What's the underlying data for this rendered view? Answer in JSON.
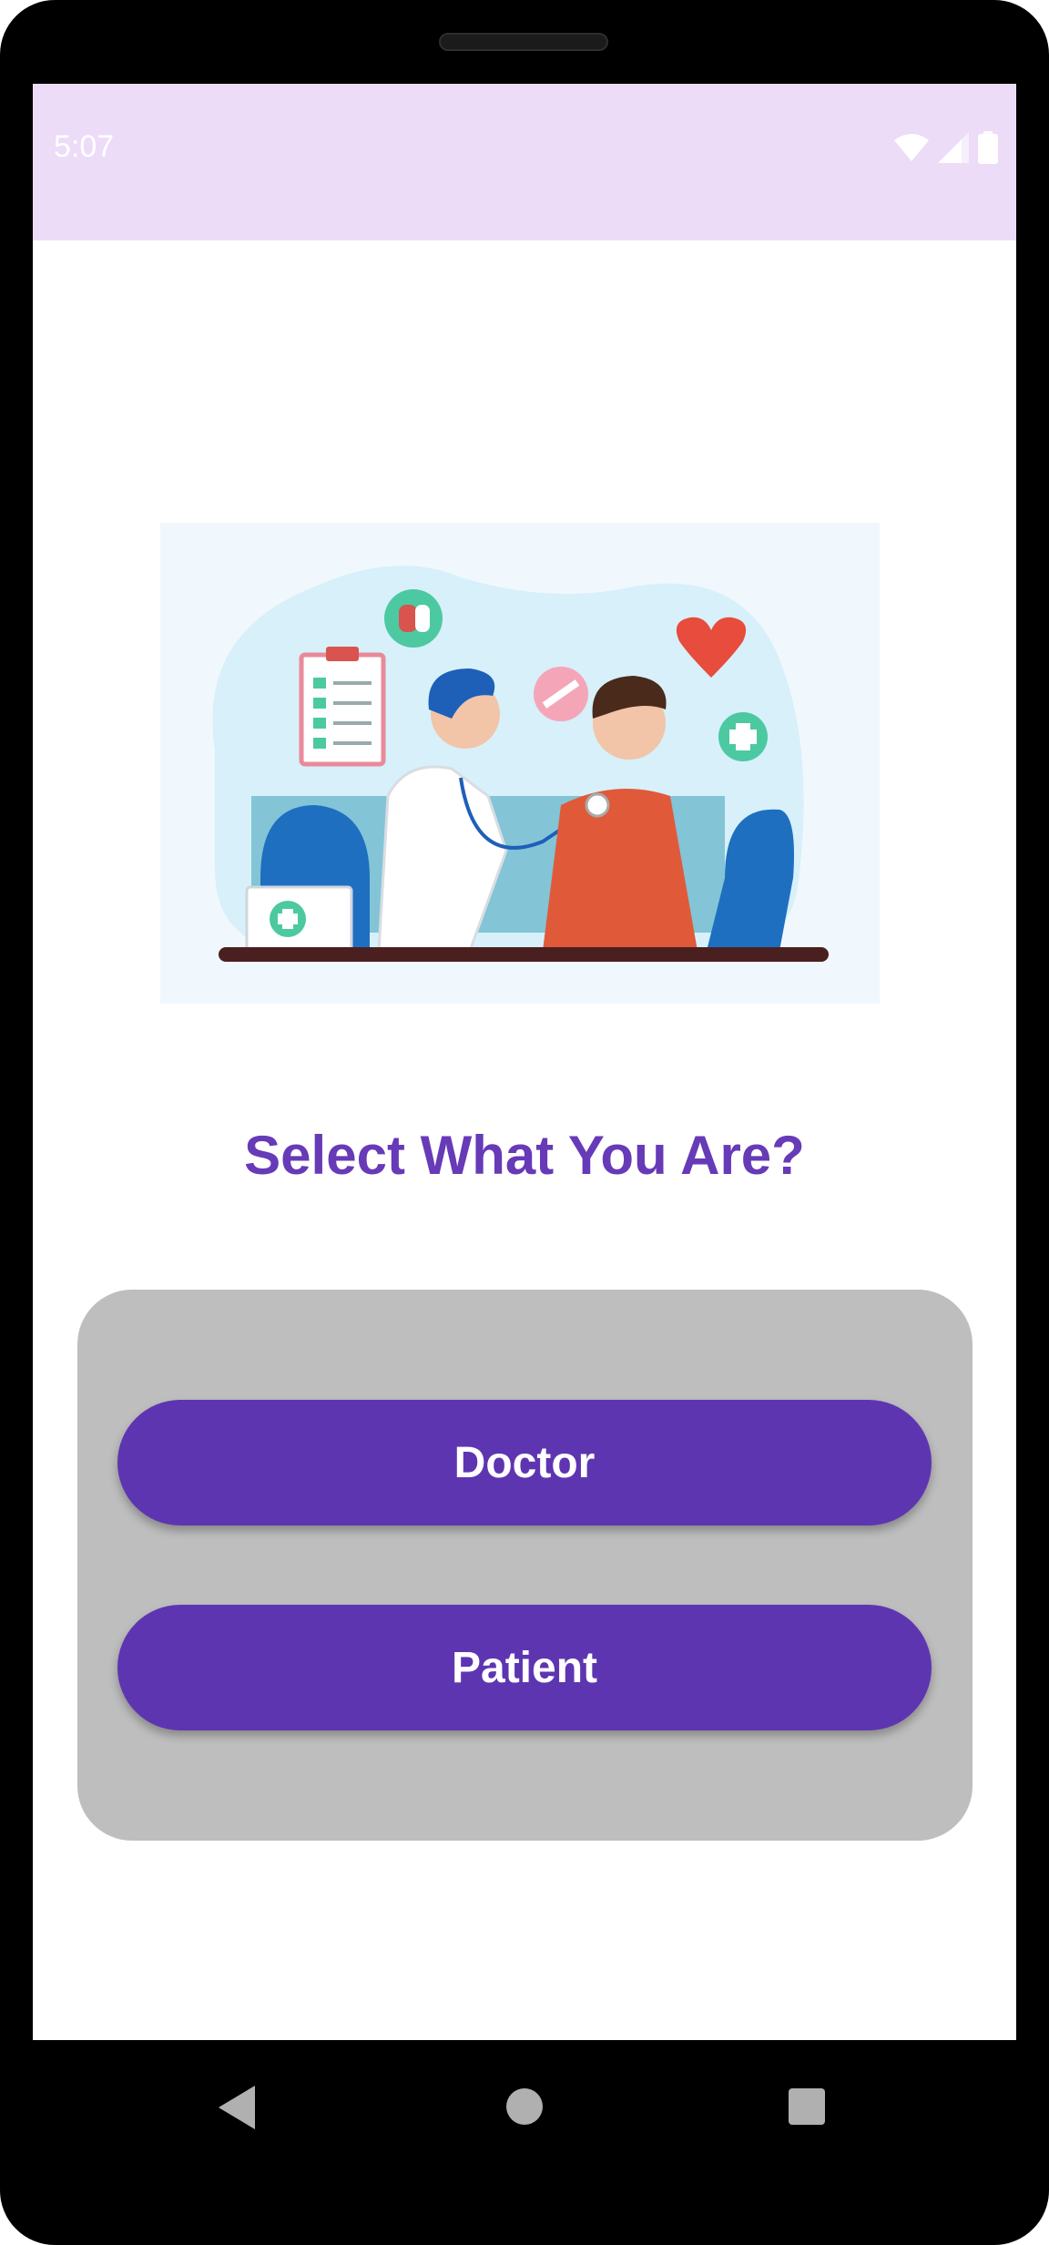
{
  "status_bar": {
    "time": "5:07",
    "icons": [
      "wifi-icon",
      "cellular-signal-icon",
      "battery-icon"
    ]
  },
  "illustration": {
    "description_icon": "doctor-checkup-illustration"
  },
  "main": {
    "title": "Select What You Are?",
    "buttons": {
      "doctor_label": "Doctor",
      "patient_label": "Patient"
    }
  },
  "navigation": {
    "icons": [
      "back-icon",
      "home-icon",
      "recents-icon"
    ]
  },
  "colors": {
    "status_bar_bg": "#ecdcf8",
    "accent": "#673ab7",
    "button_bg": "#5e35b1",
    "card_bg": "#bebebe"
  }
}
